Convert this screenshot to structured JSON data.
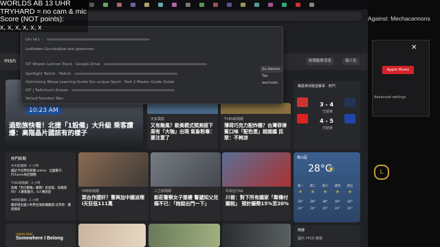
{
  "overlay": {
    "line1": "WORLDS AB 13 UHR",
    "line2": "TRYHARD = no cam & mic",
    "line3": "Score (NOT points):",
    "line4": "x, x, x, x, x, x"
  },
  "right_panel": {
    "title": "Against: Mechacannons",
    "button": "Apple Music",
    "close": "✕",
    "setting": "Advanced settings"
  },
  "dropdown": {
    "rows": [
      "Uni ist1 · ",
      "Leitfaden Grundsätze test gewinnen",
      "IST Wissen Lennon Track · Google Drive",
      "Spotlight Twitch · Twitch",
      "Optimizing Wisse Learning Guide the unique Sport · Part 2 Master Guide Guide",
      "IST | Twitchuo's Known"
    ],
    "switch_label": "Zu diesem Tab wechseln",
    "footer": "Verlauf   Favoriten   Tabs"
  },
  "header": {
    "logo": "msn",
    "btn1": "新聞動態消息",
    "btn2": "個人化"
  },
  "cards": {
    "main_title": "過勁族快看！北捷「1設備」大升級 乘客讚爆：高階晶片國該有的樣子",
    "time": "10:23 AM",
    "c2_title": "又有颱風？歐美模式預測接下周有「大咖」出現 氣象粉專：要注意了",
    "c2_src": "天氣風險",
    "c3_title": "薄荷巧克力配炸雞？台灣菲律賓口味「配色蛋」超詭譎 民眾：不夠凉",
    "c3_src": "TVBS新聞網",
    "c4_title": "郭台作證奸？曹與加中國派理 i天狂低111萬",
    "c4_src": "中時新聞網",
    "c5_title": "新莊警察女子墜樓 警遞知父兒痛不已：「她說出門一下」",
    "c5_src": "三立新聞網",
    "c6_title": "川普：對下所有國家「鄰傳付關稅」 預計擬徵15%至20%",
    "c6_src": "中央社CNA",
    "left_list_header": "熱門新聞",
    "left_items": [
      "中天新聞網 · 2 小時",
      "國記卡任學校新聞 online · 全國電子，PChome商店開戰",
      "TVBS新聞網 · 2 小時",
      "高端「百已電傷」機開！民進黨，高端證95！人數範圍大，6人傳說說",
      "中時新聞網 · 2 小時",
      "最新發生國人利用台灣新聞驗證 北市府：價值報表"
    ]
  },
  "scores": {
    "header": "職業棒球聯盟賽事 · 熱門",
    "game1": "3 - 4",
    "game2": "4 - 5",
    "label1": "已結束",
    "label2": "已結束"
  },
  "weather": {
    "location": "桃山區",
    "temp": "28°C",
    "days": [
      "週一",
      "週二",
      "週三",
      "週四",
      "週五"
    ],
    "highs": [
      "32°",
      "34°",
      "34°",
      "33°",
      "32°"
    ],
    "lows": [
      "24°",
      "26°",
      "26°",
      "26°",
      "26°"
    ]
  },
  "bottom": {
    "band": "LINKIN PARK",
    "song": "Somewhere I Belong",
    "panel_title": "熱搜",
    "panel_item": "國內 TPCE 機場"
  },
  "colors": {
    "accent_red": "#d4222a",
    "time_badge": "#1f4f9c",
    "weather_bg": "#3b5f8e"
  }
}
